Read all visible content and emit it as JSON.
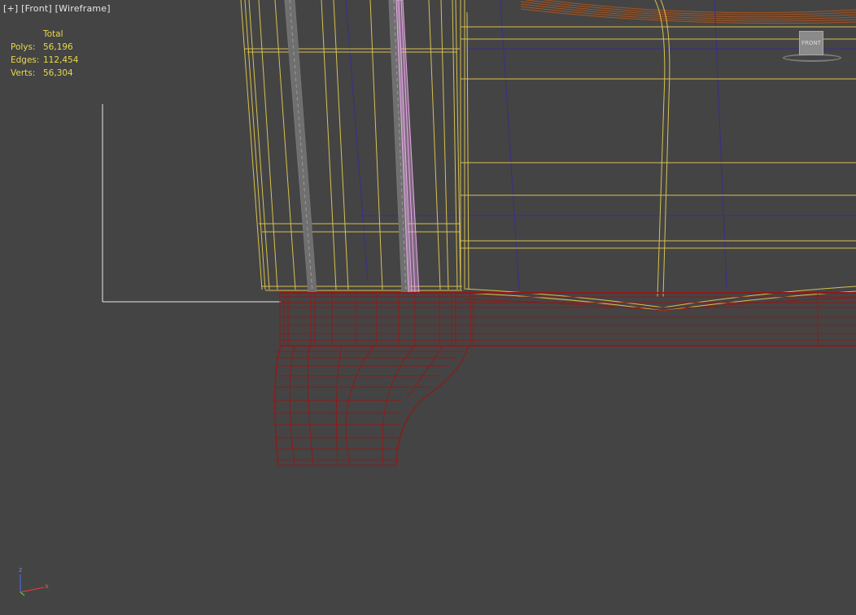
{
  "viewport": {
    "label": {
      "plus": "[+]",
      "view": "[Front]",
      "shading": "[Wireframe]"
    },
    "stats": {
      "header": "Total",
      "rows": [
        {
          "label": "Polys:",
          "value": "56,196"
        },
        {
          "label": "Edges:",
          "value": "112,454"
        },
        {
          "label": "Verts:",
          "value": "56,304"
        }
      ]
    },
    "viewcube": {
      "face": "FRONT"
    },
    "axis": {
      "z": "z",
      "x": "x"
    }
  },
  "colors": {
    "background": "#444444",
    "yellow_wire": "#d8c150",
    "red_wire": "#8e1a1a",
    "blue_wire": "#3a2d8a",
    "orange_wire": "#a8541e",
    "pink_selection": "#e8a8e8",
    "stats_text": "#e7d94a"
  }
}
